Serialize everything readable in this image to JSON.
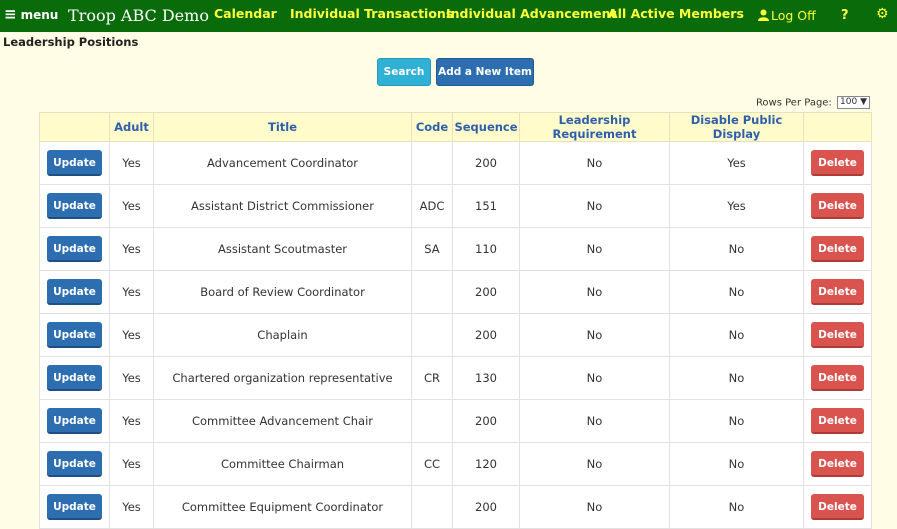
{
  "nav": {
    "menu_label": "menu",
    "brand": "Troop ABC Demo",
    "links": [
      "Calendar",
      "Individual Transactions",
      "Individual Advancement",
      "All Active Members"
    ],
    "logoff": "Log Off",
    "help": "?",
    "settings_icon": "gear-icon",
    "bar_color": "#0a6b0a",
    "link_color": "#ffff3c"
  },
  "page_title": "Leadership Positions",
  "toolbar": {
    "search_label": "Search",
    "add_label": "Add a New Item"
  },
  "rows_per_page": {
    "label": "Rows Per Page:",
    "value": "100"
  },
  "table": {
    "headers": [
      "",
      "Adult",
      "Title",
      "Code",
      "Sequence",
      "Leadership Requirement",
      "Disable Public Display",
      ""
    ],
    "update_label": "Update",
    "delete_label": "Delete",
    "rows": [
      {
        "adult": "Yes",
        "title": "Advancement Coordinator",
        "code": "",
        "sequence": "200",
        "req": "No",
        "disable": "Yes"
      },
      {
        "adult": "Yes",
        "title": "Assistant District Commissioner",
        "code": "ADC",
        "sequence": "151",
        "req": "No",
        "disable": "Yes"
      },
      {
        "adult": "Yes",
        "title": "Assistant Scoutmaster",
        "code": "SA",
        "sequence": "110",
        "req": "No",
        "disable": "No"
      },
      {
        "adult": "Yes",
        "title": "Board of Review Coordinator",
        "code": "",
        "sequence": "200",
        "req": "No",
        "disable": "No"
      },
      {
        "adult": "Yes",
        "title": "Chaplain",
        "code": "",
        "sequence": "200",
        "req": "No",
        "disable": "No"
      },
      {
        "adult": "Yes",
        "title": "Chartered organization representative",
        "code": "CR",
        "sequence": "130",
        "req": "No",
        "disable": "No"
      },
      {
        "adult": "Yes",
        "title": "Committee Advancement Chair",
        "code": "",
        "sequence": "200",
        "req": "No",
        "disable": "No"
      },
      {
        "adult": "Yes",
        "title": "Committee Chairman",
        "code": "CC",
        "sequence": "120",
        "req": "No",
        "disable": "No"
      },
      {
        "adult": "Yes",
        "title": "Committee Equipment Coordinator",
        "code": "",
        "sequence": "200",
        "req": "No",
        "disable": "No"
      }
    ]
  }
}
